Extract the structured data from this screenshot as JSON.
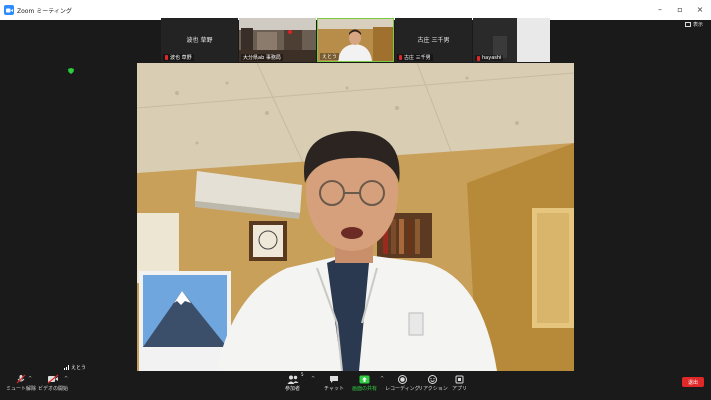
{
  "window": {
    "title": "Zoom ミーティング"
  },
  "top_right": {
    "view_label": "表示"
  },
  "participants": [
    {
      "center_name": "波也 草野",
      "tag_name": "波也 草野",
      "muted": true
    },
    {
      "center_name": "",
      "tag_name": "大分県ab 事務局",
      "muted": false
    },
    {
      "center_name": "",
      "tag_name": "えとう",
      "muted": false,
      "active": true
    },
    {
      "center_name": "古庄 三千男",
      "tag_name": "古庄 三千男",
      "muted": true
    },
    {
      "center_name": "",
      "tag_name": "hayashi",
      "muted": true
    }
  ],
  "self_view": {
    "name": "えとう"
  },
  "toolbar": {
    "mute_label": "ミュート解除",
    "video_label": "ビデオの開始",
    "participants_label": "参加者",
    "participants_count": "5",
    "chat_label": "チャット",
    "share_label": "画面の共有",
    "record_label": "レコーディング",
    "reactions_label": "リアクション",
    "apps_label": "アプリ",
    "leave_label": "退出"
  },
  "colors": {
    "share_green": "#2ecc40",
    "leave_red": "#e02828",
    "active_border": "#7ac943"
  }
}
